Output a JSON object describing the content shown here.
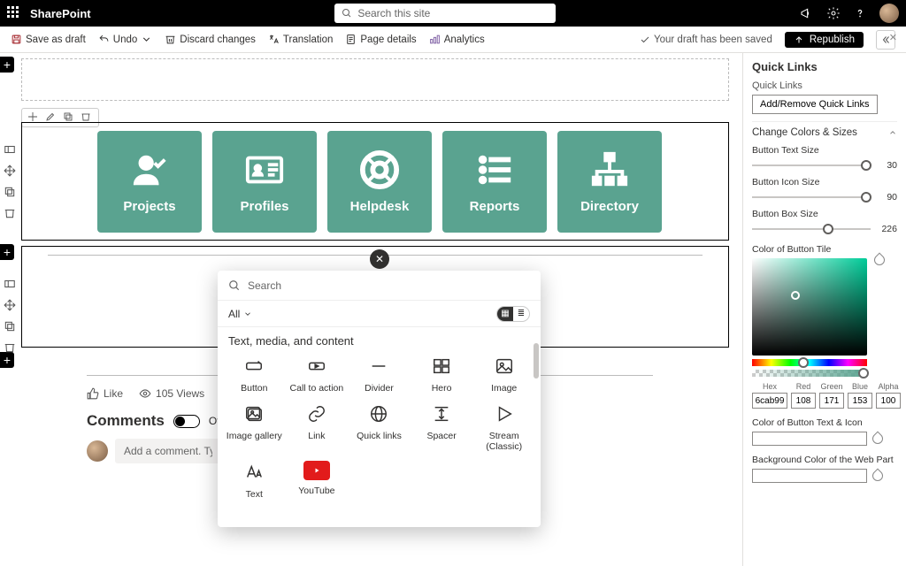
{
  "topbar": {
    "brand": "SharePoint",
    "search_placeholder": "Search this site"
  },
  "cmdbar": {
    "save": "Save as draft",
    "undo": "Undo",
    "discard": "Discard changes",
    "translation": "Translation",
    "details": "Page details",
    "analytics": "Analytics",
    "saved_status": "Your draft has been saved",
    "republish": "Republish"
  },
  "tiles": [
    {
      "label": "Projects",
      "icon": "person-check"
    },
    {
      "label": "Profiles",
      "icon": "id-card"
    },
    {
      "label": "Helpdesk",
      "icon": "life-ring"
    },
    {
      "label": "Reports",
      "icon": "list"
    },
    {
      "label": "Directory",
      "icon": "org-chart"
    }
  ],
  "picker": {
    "search_placeholder": "Search",
    "filter": "All",
    "category": "Text, media, and content",
    "webparts": [
      "Button",
      "Call to action",
      "Divider",
      "Hero",
      "Image",
      "Image gallery",
      "Link",
      "Quick links",
      "Spacer",
      "Stream (Classic)",
      "Text",
      "YouTube"
    ]
  },
  "footer": {
    "like": "Like",
    "views": "105 Views",
    "comments_header": "Comments",
    "toggle_label": "Off",
    "comment_placeholder": "Add a comment. Type @ to mention someone."
  },
  "props": {
    "title": "Quick Links",
    "subtitle": "Quick Links",
    "add_remove": "Add/Remove Quick Links",
    "accordion": "Change Colors & Sizes",
    "sliders": [
      {
        "label": "Button Text Size",
        "value": "30",
        "knob_pct": 92
      },
      {
        "label": "Button Icon Size",
        "value": "90",
        "knob_pct": 92
      },
      {
        "label": "Button Box Size",
        "value": "226",
        "knob_pct": 60
      }
    ],
    "color_label": "Color of Button Tile",
    "hex": {
      "hex": "6cab99",
      "r": "108",
      "g": "171",
      "b": "153",
      "a": "100"
    },
    "hexlabels": {
      "hex": "Hex",
      "r": "Red",
      "g": "Green",
      "b": "Blue",
      "a": "Alpha"
    },
    "texticon_label": "Color of Button Text & Icon",
    "bg_label": "Background Color of the Web Part"
  }
}
